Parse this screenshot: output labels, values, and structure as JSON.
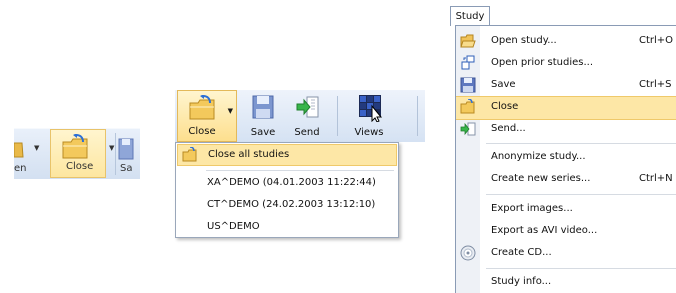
{
  "left_toolbar": {
    "open_label": "en",
    "close_label": "Close",
    "save_label": "Sa"
  },
  "middle_toolbar": {
    "buttons": [
      {
        "label": "Close",
        "icon": "folder-open-icon"
      },
      {
        "label": "Save",
        "icon": "floppy-disk-icon"
      },
      {
        "label": "Send",
        "icon": "send-icon"
      },
      {
        "label": "Views",
        "icon": "views-grid-icon"
      }
    ],
    "menu": {
      "close_all": "Close all studies",
      "studies": [
        "XA^DEMO (04.01.2003 11:22:44)",
        "CT^DEMO (24.02.2003 13:12:10)",
        "US^DEMO"
      ]
    }
  },
  "study_menu": {
    "tab_label": "Study",
    "items": [
      {
        "label": "Open study...",
        "shortcut": "Ctrl+O",
        "icon": "folder-open-icon"
      },
      {
        "label": "Open prior studies...",
        "shortcut": "",
        "icon": "prior-studies-icon"
      },
      {
        "label": "Save",
        "shortcut": "Ctrl+S",
        "icon": "floppy-disk-icon"
      },
      {
        "label": "Close",
        "shortcut": "",
        "icon": "folder-close-icon"
      },
      {
        "label": "Send...",
        "shortcut": "",
        "icon": "send-icon"
      },
      {
        "label": "Anonymize study...",
        "shortcut": "",
        "icon": ""
      },
      {
        "label": "Create new series...",
        "shortcut": "Ctrl+N",
        "icon": ""
      },
      {
        "label": "Export images...",
        "shortcut": "",
        "icon": ""
      },
      {
        "label": "Export as AVI video...",
        "shortcut": "",
        "icon": ""
      },
      {
        "label": "Create CD...",
        "shortcut": "",
        "icon": "cd-icon"
      },
      {
        "label": "Study info...",
        "shortcut": "",
        "icon": ""
      }
    ]
  },
  "colors": {
    "highlight": "#fde7a6",
    "toolbar": "#dbe6f4",
    "border": "#8a9bb5"
  }
}
